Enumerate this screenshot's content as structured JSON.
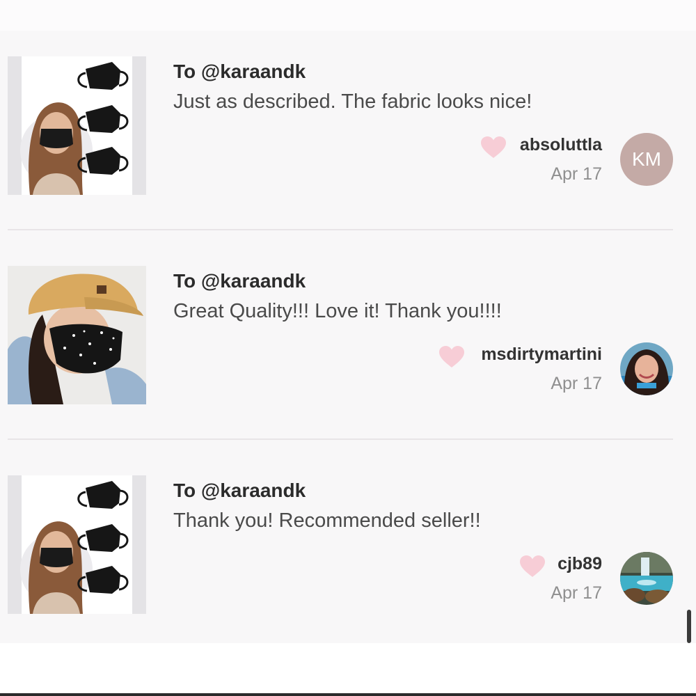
{
  "reviews": [
    {
      "to": "To @karaandk",
      "message": "Just as described. The fabric looks nice!",
      "username": "absoluttla",
      "date": "Apr 17",
      "avatar_initials": "KM",
      "image": "woman-wearing-black-face-masks-three-pack"
    },
    {
      "to": "To @karaandk",
      "message": "Great Quality!!! Love it! Thank you!!!!",
      "username": "msdirtymartini",
      "date": "Apr 17",
      "avatar": "user-photo",
      "image": "woman-in-cap-wearing-star-print-mask"
    },
    {
      "to": "To @karaandk",
      "message": "Thank you! Recommended seller!!",
      "username": "cjb89",
      "date": "Apr 17",
      "avatar": "waterfall-photo",
      "image": "woman-wearing-black-face-masks-three-pack"
    }
  ],
  "colors": {
    "heart": "#f7cdd6",
    "km_avatar": "#c4aaa6",
    "divider": "#e8e4e7"
  }
}
